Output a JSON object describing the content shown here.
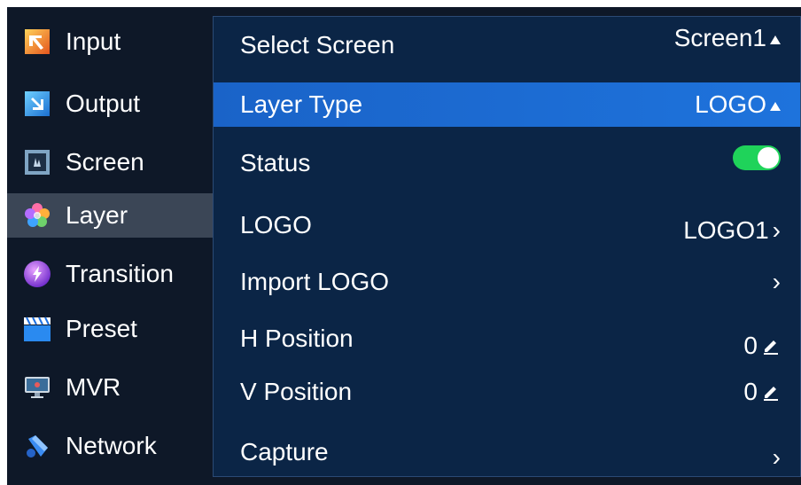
{
  "sidebar": {
    "items": [
      {
        "label": "Input",
        "icon": "input-icon"
      },
      {
        "label": "Output",
        "icon": "output-icon"
      },
      {
        "label": "Screen",
        "icon": "screen-icon"
      },
      {
        "label": "Layer",
        "icon": "layer-icon",
        "active": true
      },
      {
        "label": "Transition",
        "icon": "transition-icon"
      },
      {
        "label": "Preset",
        "icon": "preset-icon"
      },
      {
        "label": "MVR",
        "icon": "mvr-icon"
      },
      {
        "label": "Network",
        "icon": "network-icon"
      }
    ]
  },
  "settings": {
    "select_screen": {
      "label": "Select Screen",
      "value": "Screen1"
    },
    "layer_type": {
      "label": "Layer Type",
      "value": "LOGO"
    },
    "status": {
      "label": "Status",
      "enabled": true
    },
    "logo": {
      "label": "LOGO",
      "value": "LOGO1"
    },
    "import_logo": {
      "label": "Import LOGO"
    },
    "h_position": {
      "label": "H Position",
      "value": "0"
    },
    "v_position": {
      "label": "V Position",
      "value": "0"
    },
    "capture": {
      "label": "Capture"
    }
  },
  "colors": {
    "background": "#0e1828",
    "panel": "#0b2546",
    "selected_row": "#1e6bd6",
    "toggle_on": "#1fd35a",
    "sidebar_active": "#3b4656"
  }
}
